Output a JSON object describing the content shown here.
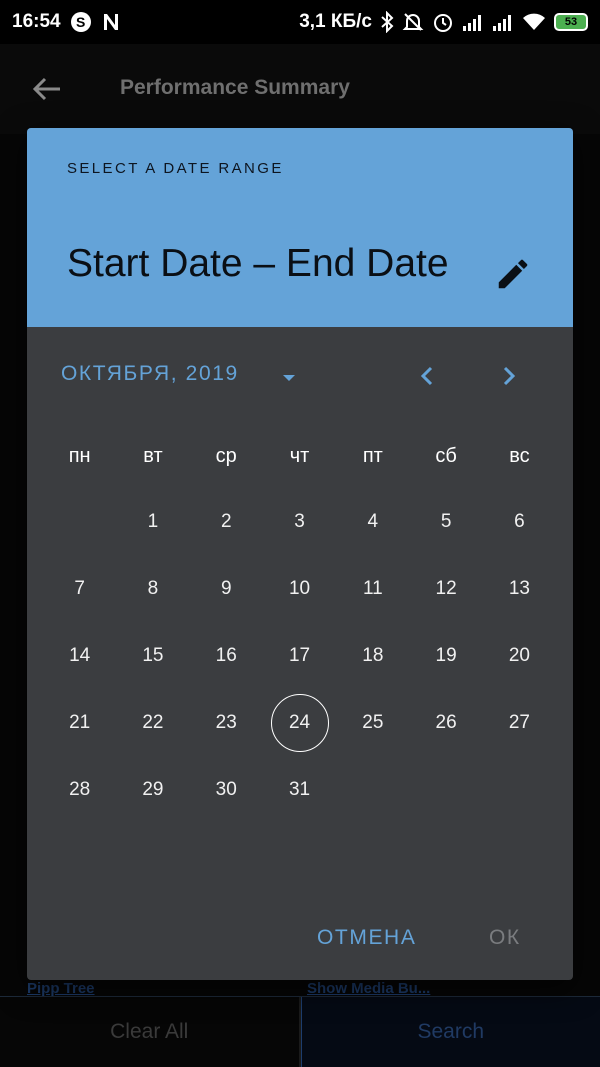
{
  "status_bar": {
    "time": "16:54",
    "left_icons": [
      "skype-icon",
      "n-notification-icon"
    ],
    "speed": "3,1 КБ/с",
    "battery": "53",
    "right_icons": [
      "bluetooth-icon",
      "mute-icon",
      "alarm-icon",
      "signal-icon",
      "signal-icon",
      "wifi-icon",
      "battery-icon"
    ]
  },
  "app_bar": {
    "title": "Performance Summary"
  },
  "underlay": {
    "left_link": "Pipp Tree",
    "right_link": "Show Media Bu...",
    "clear_label": "Clear All",
    "search_label": "Search"
  },
  "dialog": {
    "help_text": "SELECT A DATE RANGE",
    "range_text": "Start Date – End Date",
    "month_label": "ОКТЯБРЯ, 2019",
    "weekdays": [
      "пн",
      "вт",
      "ср",
      "чт",
      "пт",
      "сб",
      "вс"
    ],
    "days": [
      "",
      "1",
      "2",
      "3",
      "4",
      "5",
      "6",
      "7",
      "8",
      "9",
      "10",
      "11",
      "12",
      "13",
      "14",
      "15",
      "16",
      "17",
      "18",
      "19",
      "20",
      "21",
      "22",
      "23",
      "24",
      "25",
      "26",
      "27",
      "28",
      "29",
      "30",
      "31"
    ],
    "today": "24",
    "cancel_label": "ОТМЕНА",
    "ok_label": "ОК"
  },
  "colors": {
    "accent": "#64a3d8",
    "dialog_bg": "#3b3d40",
    "disabled": "#7a7c7f"
  }
}
